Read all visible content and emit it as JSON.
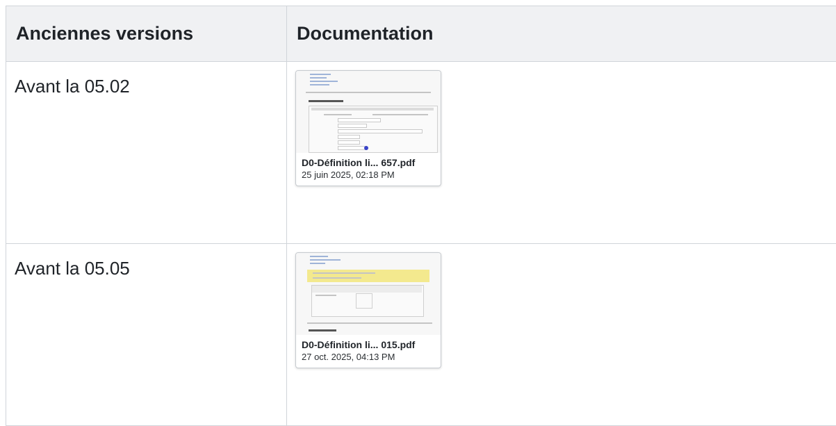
{
  "table": {
    "headers": [
      "Anciennes versions",
      "Documentation"
    ],
    "rows": [
      {
        "label": "Avant la 05.02",
        "document": {
          "name": "D0-Définition li... 657.pdf",
          "date": "25 juin 2025, 02:18 PM"
        }
      },
      {
        "label": "Avant la 05.05",
        "document": {
          "name": "D0-Définition li... 015.pdf",
          "date": "27 oct. 2025, 04:13 PM"
        }
      }
    ]
  },
  "icons": [
    "pdf-thumbnail"
  ]
}
